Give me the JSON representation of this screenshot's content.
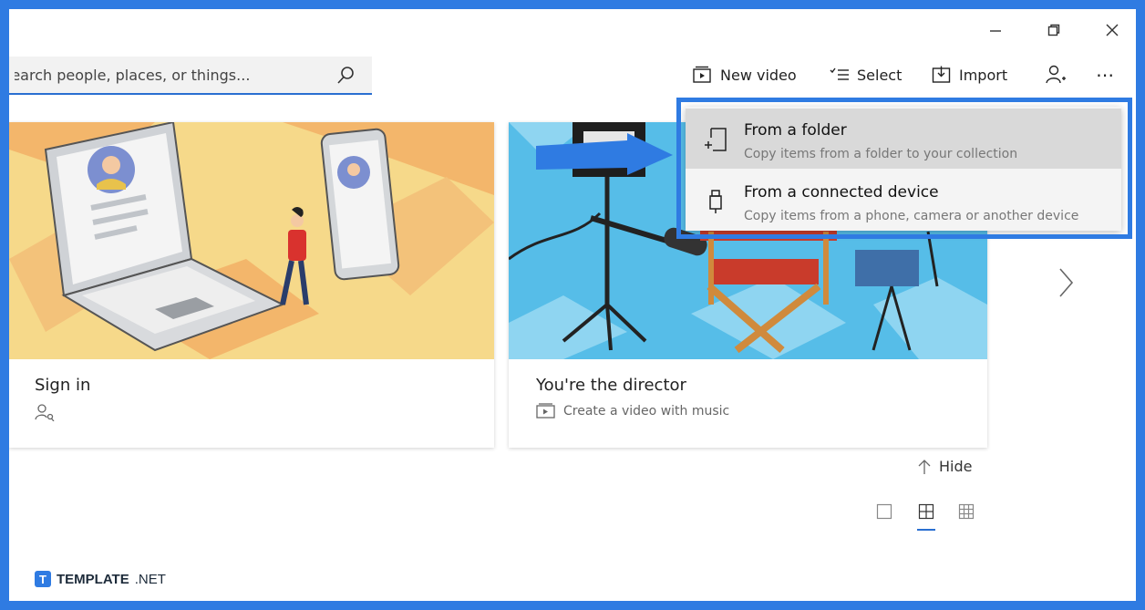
{
  "search": {
    "placeholder": "search people, places, or things..."
  },
  "toolbar": {
    "new_video": "New video",
    "select": "Select",
    "import": "Import"
  },
  "cards": [
    {
      "title": "Sign in"
    },
    {
      "title": "You're the director",
      "subtitle": "Create a video with music"
    }
  ],
  "import_menu": {
    "items": [
      {
        "title": "From a folder",
        "description": "Copy items from a folder to your collection"
      },
      {
        "title": "From a connected device",
        "description": "Copy items from a phone, camera or another device"
      }
    ]
  },
  "hide_label": "Hide",
  "watermark": {
    "brand": "TEMPLATE",
    "suffix": ".NET",
    "logo_letter": "T"
  },
  "colors": {
    "accent": "#2f7be2",
    "selection_underline": "#2a6fd1"
  }
}
